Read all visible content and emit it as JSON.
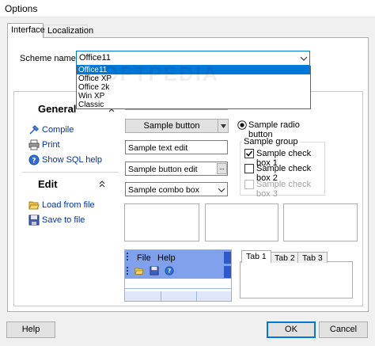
{
  "window": {
    "title": "Options"
  },
  "tabs": [
    {
      "label": "Interface"
    },
    {
      "label": "Localization"
    }
  ],
  "scheme": {
    "label": "Scheme name",
    "value": "Office11",
    "options": [
      "Office11",
      "Office XP",
      "Office 2k",
      "Win XP",
      "Classic"
    ]
  },
  "watermark": "SOFTPEDIA",
  "nav": {
    "general": {
      "title": "General",
      "items": [
        {
          "label": "Compile"
        },
        {
          "label": "Print"
        },
        {
          "label": "Show SQL help"
        }
      ]
    },
    "edit": {
      "title": "Edit",
      "items": [
        {
          "label": "Load from file"
        },
        {
          "label": "Save to file"
        }
      ]
    }
  },
  "samples": {
    "button": "Sample button",
    "radio": "Sample radio button",
    "text_edit": "Sample text edit",
    "button_edit": "Sample button edit",
    "button_edit_glyph": "...",
    "combo_box": "Sample combo box",
    "group_title": "Sample group",
    "checks": [
      {
        "label": "Sample check box 1",
        "checked": true,
        "enabled": true
      },
      {
        "label": "Sample check box 2",
        "checked": false,
        "enabled": true
      },
      {
        "label": "Sample check box 3",
        "checked": false,
        "enabled": false
      }
    ],
    "menu": {
      "file": "File",
      "help": "Help"
    },
    "tabs": [
      "Tab 1",
      "Tab 2",
      "Tab 3"
    ]
  },
  "buttons": {
    "help": "Help",
    "ok": "OK",
    "cancel": "Cancel"
  },
  "colors": {
    "accent": "#0078d7",
    "office_bar": "#2f57d0",
    "link": "#0033aa"
  }
}
